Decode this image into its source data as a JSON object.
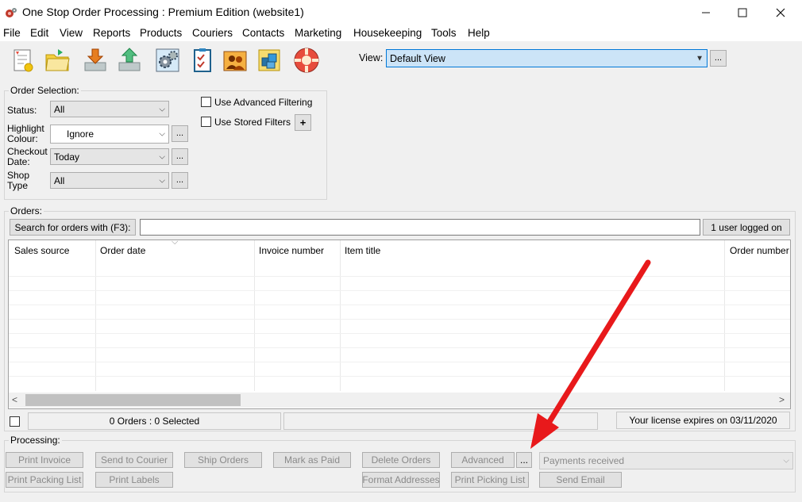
{
  "window": {
    "title": "One Stop Order Processing : Premium Edition (website1)",
    "minimize": "—",
    "maximize": "☐",
    "close": "✕"
  },
  "menu": [
    "File",
    "Edit",
    "View",
    "Reports",
    "Products",
    "Couriers",
    "Contacts",
    "Marketing",
    "Housekeeping",
    "Tools",
    "Help"
  ],
  "toolbar_icons": [
    "new-order-icon",
    "open-folder-icon",
    "download-orders-icon",
    "upload-orders-icon",
    "settings-gears-icon",
    "checklist-icon",
    "contacts-icon",
    "products-icon",
    "help-lifebuoy-icon"
  ],
  "view": {
    "label": "View:",
    "value": "Default View",
    "more": "..."
  },
  "order_selection": {
    "title": "Order Selection:",
    "status_label": "Status:",
    "status_value": "All",
    "highlight_label_1": "Highlight",
    "highlight_label_2": "Colour:",
    "highlight_value": "Ignore",
    "checkout_label_1": "Checkout",
    "checkout_label_2": "Date:",
    "checkout_value": "Today",
    "shop_label_1": "Shop",
    "shop_label_2": "Type",
    "shop_value": "All",
    "more": "...",
    "advanced_filtering": "Use Advanced Filtering",
    "stored_filters": "Use Stored Filters",
    "add": "+"
  },
  "orders": {
    "title": "Orders:",
    "search_button": "Search for orders with (F3):",
    "search_value": "",
    "users_button": "1 user logged on",
    "columns": [
      "Sales source",
      "Order date",
      "Invoice number",
      "Item title",
      "Order number"
    ],
    "sort_indicator": "⌵",
    "scroll_left": "<",
    "scroll_right": ">"
  },
  "status": {
    "count_text": "0 Orders : 0 Selected",
    "license_text": "Your license expires on 03/11/2020"
  },
  "processing": {
    "title": "Processing:",
    "print_invoice": "Print Invoice",
    "print_packing_list": "Print Packing List",
    "send_to_courier": "Send to Courier",
    "print_labels": "Print Labels",
    "ship_orders": "Ship Orders",
    "mark_as_paid": "Mark as Paid",
    "delete_orders": "Delete Orders",
    "format_addresses": "Format Addresses",
    "advanced": "Advanced",
    "advanced_more": "...",
    "print_picking_list": "Print Picking List",
    "payments_received": "Payments received",
    "send_email": "Send Email"
  },
  "colors": {
    "annotation_arrow": "#e8191b",
    "view_highlight": "#cce4f7",
    "focus_border": "#0078d7"
  }
}
